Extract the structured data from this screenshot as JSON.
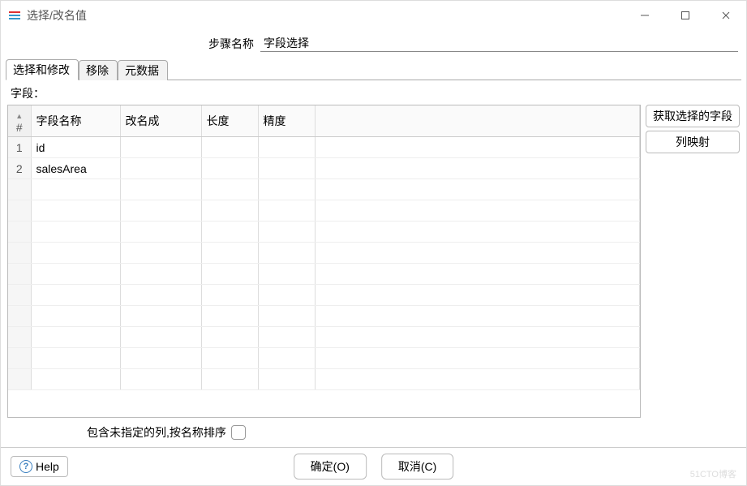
{
  "window": {
    "title": "选择/改名值"
  },
  "step": {
    "label": "步骤名称",
    "value": "字段选择"
  },
  "tabs": [
    {
      "label": "选择和修改",
      "active": true
    },
    {
      "label": "移除",
      "active": false
    },
    {
      "label": "元数据",
      "active": false
    }
  ],
  "fields_section": {
    "label": "字段："
  },
  "table": {
    "columns": {
      "rownum": "#",
      "field_name": "字段名称",
      "rename_to": "改名成",
      "length": "长度",
      "precision": "精度"
    },
    "rows": [
      {
        "n": "1",
        "field_name": "id",
        "rename_to": "",
        "length": "",
        "precision": ""
      },
      {
        "n": "2",
        "field_name": "salesArea",
        "rename_to": "",
        "length": "",
        "precision": ""
      }
    ]
  },
  "side_buttons": {
    "get_fields": "获取选择的字段",
    "column_mapping": "列映射"
  },
  "bottom_check": {
    "label": "包含未指定的列,按名称排序",
    "checked": false
  },
  "footer": {
    "help": "Help",
    "ok": "确定(O)",
    "cancel": "取消(C)"
  },
  "watermark": "51CTO博客"
}
